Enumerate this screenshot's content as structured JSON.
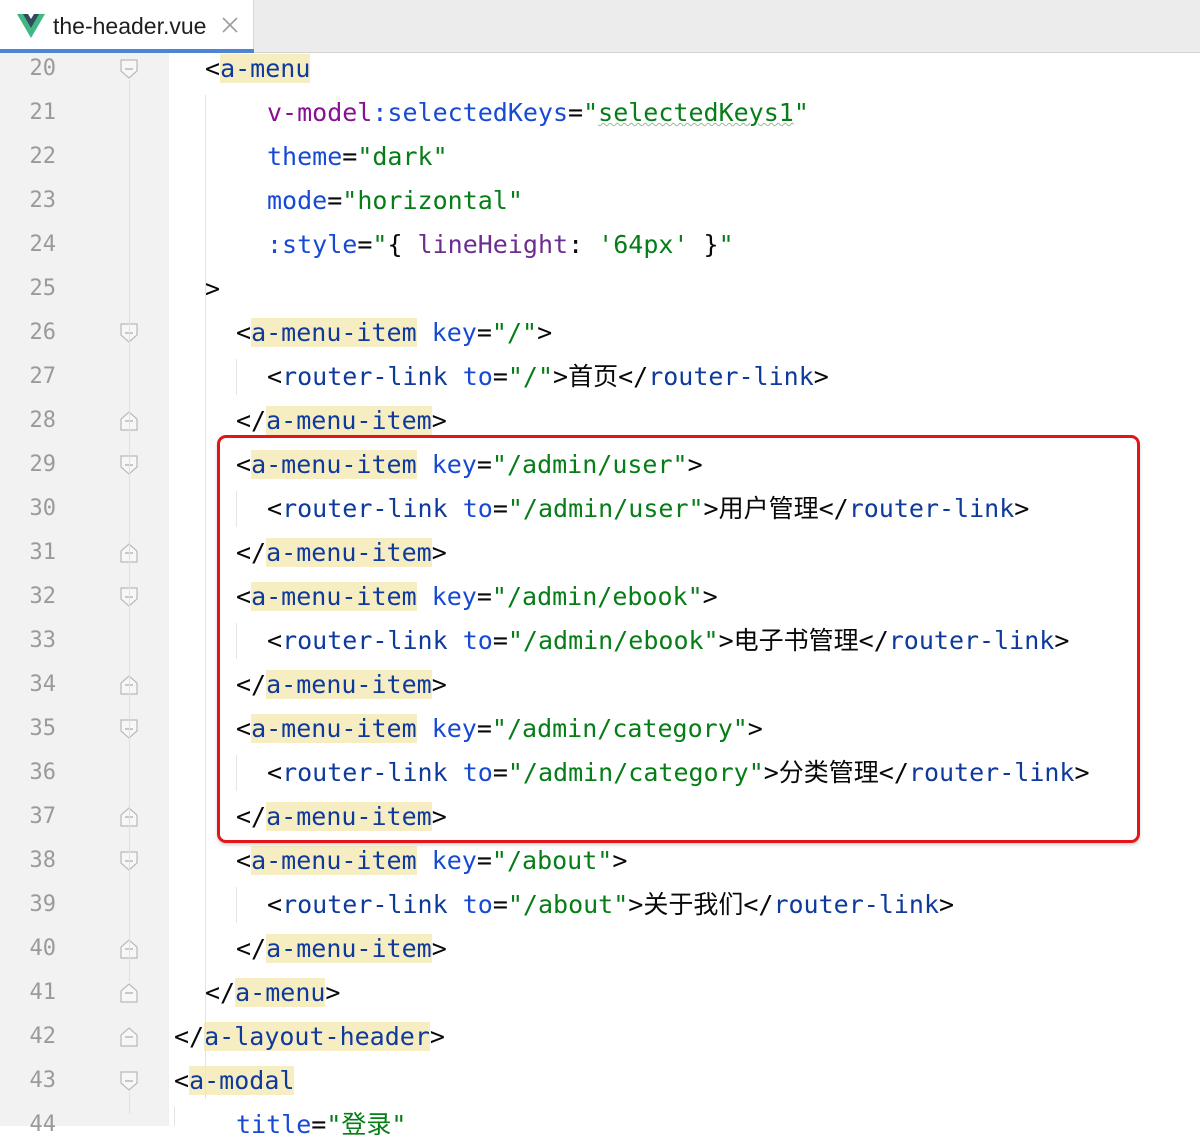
{
  "tab": {
    "title": "the-header.vue",
    "file_icon": "vue-icon",
    "close_icon": "close-icon"
  },
  "colors": {
    "tag": "#0e3a9c",
    "attribute": "#174ad4",
    "string": "#067d17",
    "directive": "#871094",
    "tag_highlight": "#f7edc2",
    "annotation_box": "#e3151a",
    "tab_accent": "#4d85d6"
  },
  "lines": [
    {
      "n": "20",
      "indent": 1,
      "fold": "open",
      "tokens": [
        [
          "p",
          "<"
        ],
        [
          "th",
          "a-menu"
        ]
      ]
    },
    {
      "n": "21",
      "indent": 3,
      "fold": "",
      "tokens": [
        [
          "d",
          "v-model"
        ],
        [
          "a",
          ":selectedKeys"
        ],
        [
          "p",
          "="
        ],
        [
          "s",
          "\""
        ],
        [
          "sq",
          "selectedKeys1"
        ],
        [
          "s",
          "\""
        ]
      ]
    },
    {
      "n": "22",
      "indent": 3,
      "fold": "",
      "tokens": [
        [
          "a",
          "theme"
        ],
        [
          "p",
          "="
        ],
        [
          "s",
          "\"dark\""
        ]
      ]
    },
    {
      "n": "23",
      "indent": 3,
      "fold": "",
      "tokens": [
        [
          "a",
          "mode"
        ],
        [
          "p",
          "="
        ],
        [
          "s",
          "\"horizontal\""
        ]
      ]
    },
    {
      "n": "24",
      "indent": 3,
      "fold": "",
      "tokens": [
        [
          "a",
          ":style"
        ],
        [
          "p",
          "="
        ],
        [
          "s",
          "\""
        ],
        [
          "p",
          "{ "
        ],
        [
          "v",
          "lineHeight"
        ],
        [
          "p",
          ": "
        ],
        [
          "s",
          "'64px'"
        ],
        [
          "p",
          " }"
        ],
        [
          "s",
          "\""
        ]
      ]
    },
    {
      "n": "25",
      "indent": 1,
      "fold": "",
      "tokens": [
        [
          "p",
          ">"
        ]
      ]
    },
    {
      "n": "26",
      "indent": 2,
      "fold": "open",
      "tokens": [
        [
          "p",
          "<"
        ],
        [
          "th",
          "a-menu-item"
        ],
        [
          "p",
          " "
        ],
        [
          "a",
          "key"
        ],
        [
          "p",
          "="
        ],
        [
          "s",
          "\"/\""
        ],
        [
          "p",
          ">"
        ]
      ]
    },
    {
      "n": "27",
      "indent": 3,
      "fold": "",
      "tokens": [
        [
          "p",
          "<"
        ],
        [
          "t",
          "router-link"
        ],
        [
          "p",
          " "
        ],
        [
          "a",
          "to"
        ],
        [
          "p",
          "="
        ],
        [
          "s",
          "\"/\""
        ],
        [
          "p",
          ">首页</"
        ],
        [
          "t",
          "router-link"
        ],
        [
          "p",
          ">"
        ]
      ]
    },
    {
      "n": "28",
      "indent": 2,
      "fold": "close",
      "tokens": [
        [
          "p",
          "</"
        ],
        [
          "th",
          "a-menu-item"
        ],
        [
          "p",
          ">"
        ]
      ]
    },
    {
      "n": "29",
      "indent": 2,
      "fold": "open",
      "tokens": [
        [
          "p",
          "<"
        ],
        [
          "th",
          "a-menu-item"
        ],
        [
          "p",
          " "
        ],
        [
          "a",
          "key"
        ],
        [
          "p",
          "="
        ],
        [
          "s",
          "\"/admin/user\""
        ],
        [
          "p",
          ">"
        ]
      ]
    },
    {
      "n": "30",
      "indent": 3,
      "fold": "",
      "tokens": [
        [
          "p",
          "<"
        ],
        [
          "t",
          "router-link"
        ],
        [
          "p",
          " "
        ],
        [
          "a",
          "to"
        ],
        [
          "p",
          "="
        ],
        [
          "s",
          "\"/admin/user\""
        ],
        [
          "p",
          ">用户管理</"
        ],
        [
          "t",
          "router-link"
        ],
        [
          "p",
          ">"
        ]
      ]
    },
    {
      "n": "31",
      "indent": 2,
      "fold": "close",
      "tokens": [
        [
          "p",
          "</"
        ],
        [
          "th",
          "a-menu-item"
        ],
        [
          "p",
          ">"
        ]
      ]
    },
    {
      "n": "32",
      "indent": 2,
      "fold": "open",
      "tokens": [
        [
          "p",
          "<"
        ],
        [
          "th",
          "a-menu-item"
        ],
        [
          "p",
          " "
        ],
        [
          "a",
          "key"
        ],
        [
          "p",
          "="
        ],
        [
          "s",
          "\"/admin/ebook\""
        ],
        [
          "p",
          ">"
        ]
      ]
    },
    {
      "n": "33",
      "indent": 3,
      "fold": "",
      "tokens": [
        [
          "p",
          "<"
        ],
        [
          "t",
          "router-link"
        ],
        [
          "p",
          " "
        ],
        [
          "a",
          "to"
        ],
        [
          "p",
          "="
        ],
        [
          "s",
          "\"/admin/ebook\""
        ],
        [
          "p",
          ">电子书管理</"
        ],
        [
          "t",
          "router-link"
        ],
        [
          "p",
          ">"
        ]
      ]
    },
    {
      "n": "34",
      "indent": 2,
      "fold": "close",
      "tokens": [
        [
          "p",
          "</"
        ],
        [
          "th",
          "a-menu-item"
        ],
        [
          "p",
          ">"
        ]
      ]
    },
    {
      "n": "35",
      "indent": 2,
      "fold": "open",
      "tokens": [
        [
          "p",
          "<"
        ],
        [
          "th",
          "a-menu-item"
        ],
        [
          "p",
          " "
        ],
        [
          "a",
          "key"
        ],
        [
          "p",
          "="
        ],
        [
          "s",
          "\"/admin/category\""
        ],
        [
          "p",
          ">"
        ]
      ]
    },
    {
      "n": "36",
      "indent": 3,
      "fold": "",
      "tokens": [
        [
          "p",
          "<"
        ],
        [
          "t",
          "router-link"
        ],
        [
          "p",
          " "
        ],
        [
          "a",
          "to"
        ],
        [
          "p",
          "="
        ],
        [
          "s",
          "\"/admin/category\""
        ],
        [
          "p",
          ">分类管理</"
        ],
        [
          "t",
          "router-link"
        ],
        [
          "p",
          ">"
        ]
      ]
    },
    {
      "n": "37",
      "indent": 2,
      "fold": "close",
      "tokens": [
        [
          "p",
          "</"
        ],
        [
          "th",
          "a-menu-item"
        ],
        [
          "p",
          ">"
        ]
      ]
    },
    {
      "n": "38",
      "indent": 2,
      "fold": "open",
      "tokens": [
        [
          "p",
          "<"
        ],
        [
          "th",
          "a-menu-item"
        ],
        [
          "p",
          " "
        ],
        [
          "a",
          "key"
        ],
        [
          "p",
          "="
        ],
        [
          "s",
          "\"/about\""
        ],
        [
          "p",
          ">"
        ]
      ]
    },
    {
      "n": "39",
      "indent": 3,
      "fold": "",
      "tokens": [
        [
          "p",
          "<"
        ],
        [
          "t",
          "router-link"
        ],
        [
          "p",
          " "
        ],
        [
          "a",
          "to"
        ],
        [
          "p",
          "="
        ],
        [
          "s",
          "\"/about\""
        ],
        [
          "p",
          ">关于我们</"
        ],
        [
          "t",
          "router-link"
        ],
        [
          "p",
          ">"
        ]
      ]
    },
    {
      "n": "40",
      "indent": 2,
      "fold": "close",
      "tokens": [
        [
          "p",
          "</"
        ],
        [
          "th",
          "a-menu-item"
        ],
        [
          "p",
          ">"
        ]
      ]
    },
    {
      "n": "41",
      "indent": 1,
      "fold": "close",
      "tokens": [
        [
          "p",
          "</"
        ],
        [
          "th",
          "a-menu"
        ],
        [
          "p",
          ">"
        ]
      ]
    },
    {
      "n": "42",
      "indent": 0,
      "fold": "close",
      "tokens": [
        [
          "p",
          "</"
        ],
        [
          "th",
          "a-layout-header"
        ],
        [
          "p",
          ">"
        ]
      ]
    },
    {
      "n": "43",
      "indent": 0,
      "fold": "open",
      "tokens": [
        [
          "p",
          "<"
        ],
        [
          "th",
          "a-modal"
        ]
      ]
    },
    {
      "n": "44",
      "indent": 2,
      "fold": "",
      "tokens": [
        [
          "a",
          "title"
        ],
        [
          "p",
          "="
        ],
        [
          "s",
          "\"登录\""
        ]
      ]
    }
  ]
}
